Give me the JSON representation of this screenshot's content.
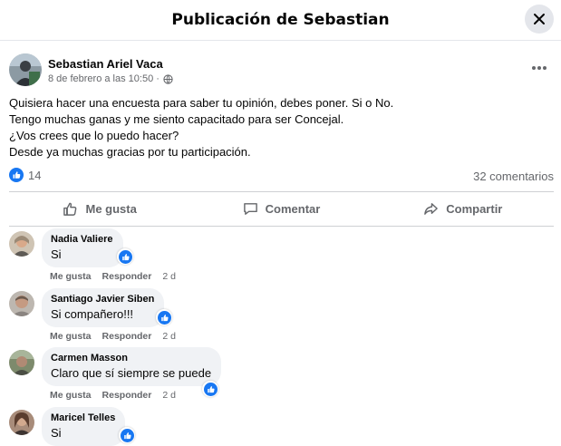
{
  "dialog": {
    "title": "Publicación de Sebastian",
    "close_icon": "close-icon"
  },
  "post": {
    "author": "Sebastian Ariel Vaca",
    "date": "8 de febrero a las 10:50 ·",
    "privacy_icon": "globe-icon",
    "text_lines": [
      "Quisiera hacer una encuesta para saber tu opinión, debes poner. Si o No.",
      "Tengo muchas ganas y me siento capacitado para ser Concejal.",
      "¿Vos crees que lo puedo hacer?",
      "Desde ya muchas gracias por tu participación."
    ],
    "like_count": "14",
    "comment_count": "32 comentarios"
  },
  "actions": {
    "like": "Me gusta",
    "comment": "Comentar",
    "share": "Compartir"
  },
  "comments": [
    {
      "name": "Nadia Valiere",
      "text": "Si",
      "like": "Me gusta",
      "reply": "Responder",
      "time": "2 d"
    },
    {
      "name": "Santiago Javier Siben",
      "text": "Si compañero!!!",
      "like": "Me gusta",
      "reply": "Responder",
      "time": "2 d"
    },
    {
      "name": "Carmen Masson",
      "text": "Claro que sí siempre se puede",
      "like": "Me gusta",
      "reply": "Responder",
      "time": "2 d"
    },
    {
      "name": "Maricel Telles",
      "text": "Si"
    }
  ],
  "colors": {
    "accent": "#1877f2",
    "secondary_text": "#65676b",
    "bubble": "#f0f2f5"
  }
}
